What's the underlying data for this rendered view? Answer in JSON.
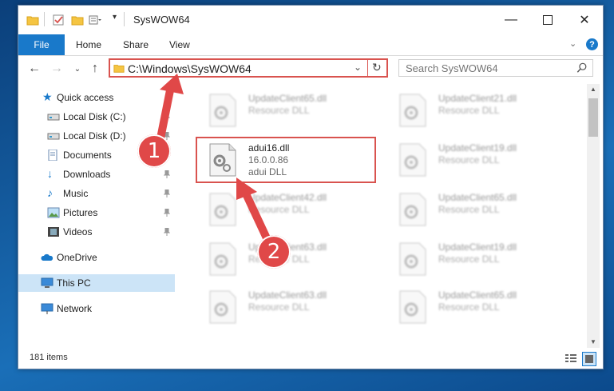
{
  "window": {
    "title": "SysWOW64"
  },
  "ribbon": {
    "tabs": [
      "File",
      "Home",
      "Share",
      "View"
    ]
  },
  "nav": {
    "address": "C:\\Windows\\SysWOW64",
    "search_placeholder": "Search SysWOW64"
  },
  "sidebar": {
    "items": [
      {
        "label": "Quick access",
        "icon": "star-icon"
      },
      {
        "label": "Local Disk (C:)",
        "icon": "drive-icon",
        "pinned": true
      },
      {
        "label": "Local Disk (D:)",
        "icon": "drive-icon",
        "pinned": true
      },
      {
        "label": "Documents",
        "icon": "documents-icon",
        "pinned": true
      },
      {
        "label": "Downloads",
        "icon": "downloads-icon",
        "pinned": true
      },
      {
        "label": "Music",
        "icon": "music-icon",
        "pinned": true
      },
      {
        "label": "Pictures",
        "icon": "pictures-icon",
        "pinned": true
      },
      {
        "label": "Videos",
        "icon": "videos-icon",
        "pinned": true
      },
      {
        "label": "OneDrive",
        "icon": "onedrive-icon"
      },
      {
        "label": "This PC",
        "icon": "this-pc-icon",
        "selected": true
      },
      {
        "label": "Network",
        "icon": "network-icon"
      }
    ]
  },
  "files": {
    "left": [
      {
        "name": "UpdateClient65.dll",
        "type": "Resource DLL"
      },
      {
        "name": "adui16.dll",
        "version": "16.0.0.86",
        "type": "adui DLL"
      },
      {
        "name": "UpdateClient42.dll",
        "type": "Resource DLL"
      },
      {
        "name": "UpdateClient63.dll",
        "type": "Resource DLL"
      },
      {
        "name": "UpdateClient63.dll",
        "type": "Resource DLL"
      }
    ],
    "right": [
      {
        "name": "UpdateClient21.dll",
        "type": "Resource DLL"
      },
      {
        "name": "UpdateClient19.dll",
        "type": "Resource DLL"
      },
      {
        "name": "UpdateClient65.dll",
        "type": "Resource DLL"
      },
      {
        "name": "UpdateClient19.dll",
        "type": "Resource DLL"
      },
      {
        "name": "UpdateClient65.dll",
        "type": "Resource DLL"
      }
    ]
  },
  "status": {
    "item_count": "181 items"
  },
  "callouts": [
    "1",
    "2"
  ],
  "colors": {
    "accent": "#1979ca",
    "highlight": "#d9534f",
    "selection": "#cce4f7"
  }
}
